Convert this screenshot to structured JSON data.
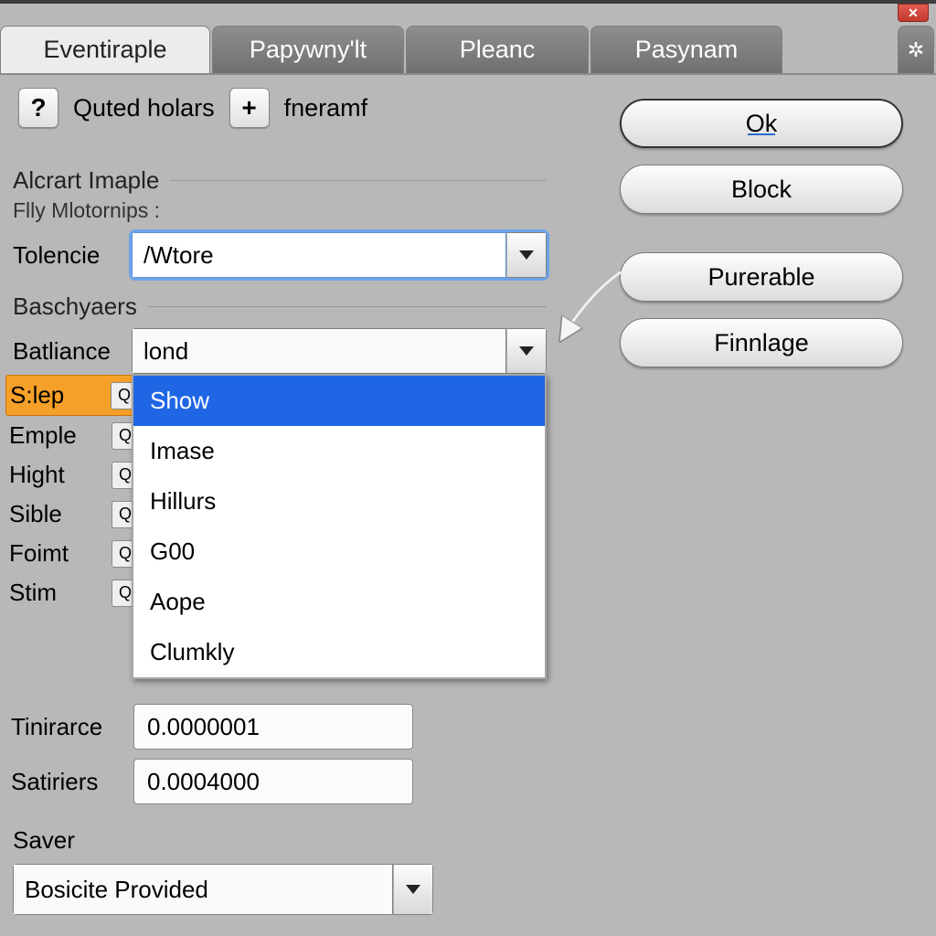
{
  "tabs": {
    "t0": "Eventiraple",
    "t1": "Papywny'lt",
    "t2": "Pleanc",
    "t3": "Pasynam"
  },
  "toolbar": {
    "help_label": "Quted holars",
    "add_label": "fneramf"
  },
  "buttons": {
    "ok": "Ok",
    "block": "Block",
    "purerable": "Purerable",
    "finnlage": "Finnlage"
  },
  "group1": {
    "title": "Alcrart Imaple",
    "sub": "Flly Mlotornips :",
    "tolencie_label": "Tolencie",
    "tolencie_value": "/Wtore"
  },
  "group2": {
    "title": "Baschyaers",
    "batliance_label": "Batliance",
    "batliance_value": "lond",
    "options": {
      "o0": "Show",
      "o1": "Imase",
      "o2": "Hillurs",
      "o3": "G00",
      "o4": "Aope",
      "o5": "Clumkly"
    }
  },
  "leftRows": {
    "r0": "S:lep",
    "r1": "Emple",
    "r2": "Hight",
    "r3": "Sible",
    "r4": "Foimt",
    "r5": "Stim"
  },
  "spinners": {
    "tinirarce_label": "Tinirarce",
    "tinirarce_value": "0.0000001",
    "satiriers_label": "Satiriers",
    "satiriers_value": "0.0004000"
  },
  "saver": {
    "label": "Saver",
    "value": "Bosicite Provided"
  },
  "icons": {
    "help": "?",
    "plus": "+",
    "gear": "✲",
    "mag": "Q",
    "x": "×",
    "check": "✓"
  }
}
